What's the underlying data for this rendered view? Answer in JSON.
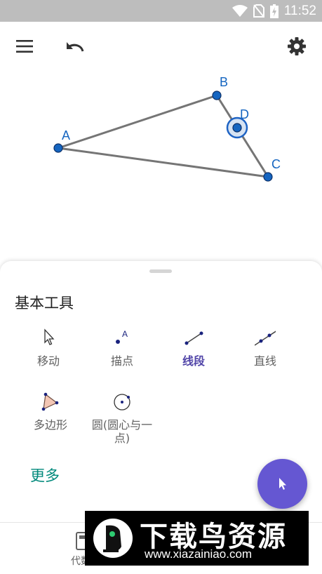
{
  "status_bar": {
    "time": "11:52",
    "icons": [
      "wifi-icon",
      "no-sim-icon",
      "battery-charging-icon"
    ],
    "background": "#bdbdbd"
  },
  "toolbar": {
    "menu_icon": "menu-icon",
    "undo_icon": "undo-icon",
    "settings_icon": "gear-icon"
  },
  "canvas": {
    "points": [
      {
        "name": "A"
      },
      {
        "name": "B"
      },
      {
        "name": "C"
      },
      {
        "name": "D"
      }
    ],
    "segments": [
      "AB",
      "BC",
      "CA"
    ],
    "point_color": "#1565c0",
    "segment_color": "#757575",
    "selected_point": "D"
  },
  "tools_panel": {
    "title": "基本工具",
    "tools": [
      {
        "label": "移动",
        "icon": "move-arrow-icon",
        "active": false
      },
      {
        "label": "描点",
        "icon": "point-icon",
        "active": false
      },
      {
        "label": "线段",
        "icon": "segment-icon",
        "active": true
      },
      {
        "label": "直线",
        "icon": "line-icon",
        "active": false
      },
      {
        "label": "多边形",
        "icon": "polygon-icon",
        "active": false
      },
      {
        "label": "圆(圆心与一点)",
        "icon": "circle-center-point-icon",
        "active": false
      }
    ],
    "more_label": "更多",
    "accent_color": "#5145a8",
    "more_color": "#00897b"
  },
  "fab": {
    "icon": "pointer-icon",
    "color": "#6557d2"
  },
  "bottom_nav": {
    "partial_label": "代数"
  },
  "watermark": {
    "title": "下载鸟资源",
    "url": "www.xiazainiao.com"
  }
}
